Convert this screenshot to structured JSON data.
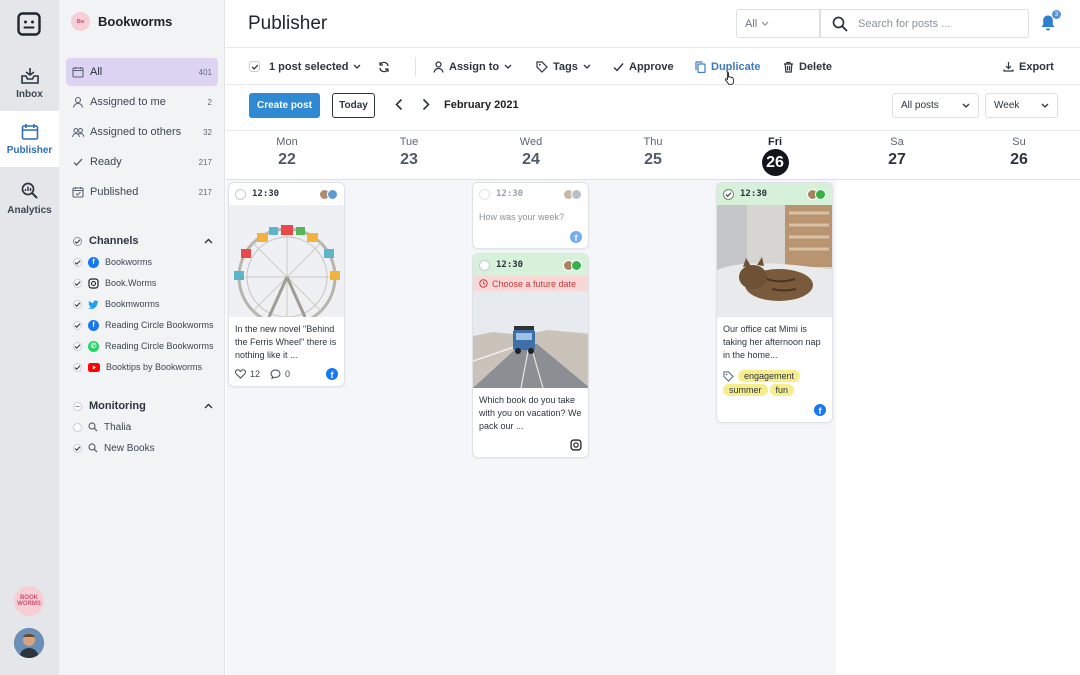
{
  "rail": {
    "items": [
      {
        "label": "Inbox"
      },
      {
        "label": "Publisher"
      },
      {
        "label": "Analytics"
      }
    ],
    "brand_text": "BOOK WORMS"
  },
  "sidebar": {
    "workspace": "Bookworms",
    "workspace_badge": "Bw",
    "nav": [
      {
        "label": "All",
        "count": "401"
      },
      {
        "label": "Assigned to me",
        "count": "2"
      },
      {
        "label": "Assigned to others",
        "count": "32"
      },
      {
        "label": "Ready",
        "count": "217"
      },
      {
        "label": "Published",
        "count": "217"
      }
    ],
    "channels_title": "Channels",
    "channels": [
      {
        "label": "Bookworms",
        "network": "facebook"
      },
      {
        "label": "Book.Worms",
        "network": "instagram"
      },
      {
        "label": "Bookmworms",
        "network": "twitter"
      },
      {
        "label": "Reading Circle Bookworms",
        "network": "facebook"
      },
      {
        "label": "Reading Circle Bookworms",
        "network": "whatsapp"
      },
      {
        "label": "Booktips by Bookworms",
        "network": "youtube"
      }
    ],
    "monitoring_title": "Monitoring",
    "monitoring": [
      {
        "label": "Thalia"
      },
      {
        "label": "New Books"
      }
    ]
  },
  "header": {
    "title": "Publisher",
    "filter_value": "All",
    "search_placeholder": "Search for posts ...",
    "notification_count": "3"
  },
  "toolbar": {
    "selected": "1 post selected",
    "assign": "Assign to",
    "tags": "Tags",
    "approve": "Approve",
    "duplicate": "Duplicate",
    "delete": "Delete",
    "export": "Export"
  },
  "controls": {
    "create": "Create post",
    "today": "Today",
    "month": "February 2021",
    "posts_filter": "All posts",
    "view": "Week"
  },
  "days": [
    {
      "name": "Mon",
      "date": "22"
    },
    {
      "name": "Tue",
      "date": "23"
    },
    {
      "name": "Wed",
      "date": "24"
    },
    {
      "name": "Thu",
      "date": "25"
    },
    {
      "name": "Fri",
      "date": "26"
    },
    {
      "name": "Sa",
      "date": "27"
    },
    {
      "name": "Su",
      "date": "26"
    }
  ],
  "posts": {
    "mon": {
      "time": "12:30",
      "text": "In the new novel \"Behind the Ferris Wheel\" there is nothing like it ...",
      "likes": "12",
      "comments": "0"
    },
    "wed1": {
      "time": "12:30",
      "text": "How was your week?"
    },
    "wed2": {
      "time": "12:30",
      "warning": "Choose a future date",
      "text": "Which book do you take with you on vacation? We pack our ..."
    },
    "fri": {
      "time": "12:30",
      "text": "Our office cat Mimi is taking her afternoon nap in the home...",
      "tags": [
        "engagement",
        "summer",
        "fun"
      ]
    }
  },
  "colors": {
    "accent": "#2f8ad3",
    "active_nav": "#ddd4f3",
    "approved": "#d6f0da",
    "warning": "#f8d7d7",
    "tag": "#f6ee8c"
  }
}
